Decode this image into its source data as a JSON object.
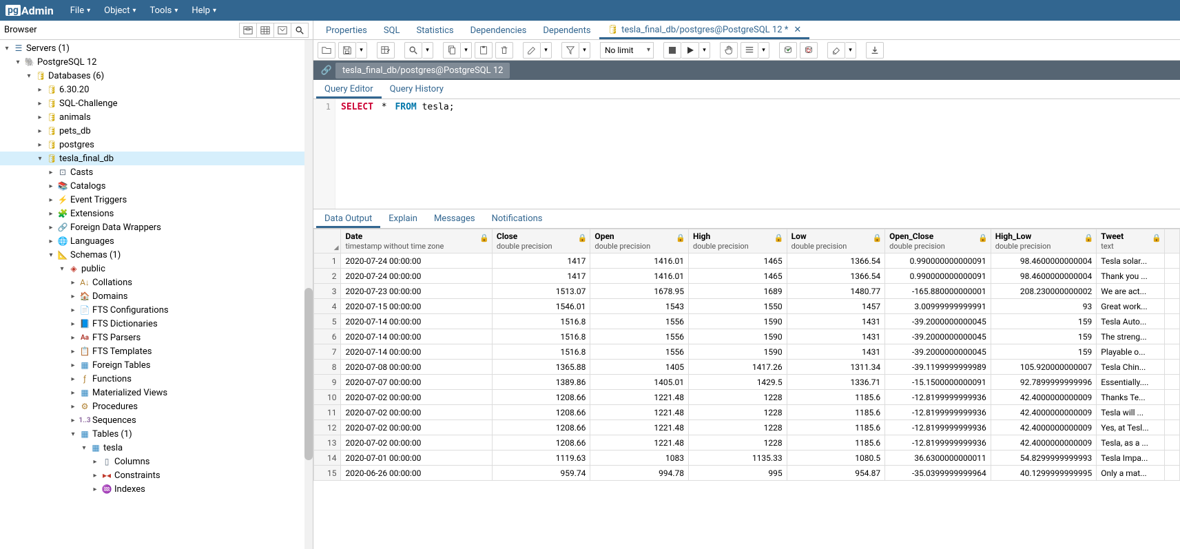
{
  "logo": {
    "pg": "pg",
    "admin": "Admin"
  },
  "menus": {
    "file": "File",
    "object": "Object",
    "tools": "Tools",
    "help": "Help"
  },
  "browser": {
    "title": "Browser"
  },
  "tree": {
    "servers": "Servers (1)",
    "pg12": "PostgreSQL 12",
    "databases": "Databases (6)",
    "db1": "6.30.20",
    "db2": "SQL-Challenge",
    "db3": "animals",
    "db4": "pets_db",
    "db5": "postgres",
    "db6": "tesla_final_db",
    "casts": "Casts",
    "catalogs": "Catalogs",
    "event_triggers": "Event Triggers",
    "extensions": "Extensions",
    "fdw": "Foreign Data Wrappers",
    "languages": "Languages",
    "schemas": "Schemas (1)",
    "public": "public",
    "collations": "Collations",
    "domains": "Domains",
    "fts_conf": "FTS Configurations",
    "fts_dict": "FTS Dictionaries",
    "fts_parsers": "FTS Parsers",
    "fts_templates": "FTS Templates",
    "foreign_tables": "Foreign Tables",
    "functions": "Functions",
    "mat_views": "Materialized Views",
    "procedures": "Procedures",
    "sequences": "Sequences",
    "tables": "Tables (1)",
    "tesla": "tesla",
    "columns": "Columns",
    "constraints": "Constraints",
    "indexes": "Indexes"
  },
  "tabs": {
    "properties": "Properties",
    "sql": "SQL",
    "statistics": "Statistics",
    "dependencies": "Dependencies",
    "dependents": "Dependents",
    "query": "tesla_final_db/postgres@PostgreSQL 12 *"
  },
  "toolbar": {
    "nolimit": "No limit"
  },
  "conn": "tesla_final_db/postgres@PostgreSQL 12",
  "editor_tabs": {
    "query_editor": "Query Editor",
    "query_history": "Query History"
  },
  "query": {
    "line": "1",
    "select": "SELECT",
    "star": "*",
    "from": "FROM",
    "rest": " tesla;"
  },
  "output_tabs": {
    "data_output": "Data Output",
    "explain": "Explain",
    "messages": "Messages",
    "notifications": "Notifications"
  },
  "cols": [
    {
      "name": "Date",
      "type": "timestamp without time zone"
    },
    {
      "name": "Close",
      "type": "double precision"
    },
    {
      "name": "Open",
      "type": "double precision"
    },
    {
      "name": "High",
      "type": "double precision"
    },
    {
      "name": "Low",
      "type": "double precision"
    },
    {
      "name": "Open_Close",
      "type": "double precision"
    },
    {
      "name": "High_Low",
      "type": "double precision"
    },
    {
      "name": "Tweet",
      "type": "text"
    }
  ],
  "rows": [
    [
      "1",
      "2020-07-24 00:00:00",
      "1417",
      "1416.01",
      "1465",
      "1366.54",
      "0.990000000000091",
      "98.4600000000004",
      "Tesla solar..."
    ],
    [
      "2",
      "2020-07-24 00:00:00",
      "1417",
      "1416.01",
      "1465",
      "1366.54",
      "0.990000000000091",
      "98.4600000000004",
      "Thank you ..."
    ],
    [
      "3",
      "2020-07-23 00:00:00",
      "1513.07",
      "1678.95",
      "1689",
      "1480.77",
      "-165.880000000001",
      "208.230000000002",
      "We are act..."
    ],
    [
      "4",
      "2020-07-15 00:00:00",
      "1546.01",
      "1543",
      "1550",
      "1457",
      "3.00999999999991",
      "93",
      "Great work..."
    ],
    [
      "5",
      "2020-07-14 00:00:00",
      "1516.8",
      "1556",
      "1590",
      "1431",
      "-39.2000000000045",
      "159",
      "Tesla Auto..."
    ],
    [
      "6",
      "2020-07-14 00:00:00",
      "1516.8",
      "1556",
      "1590",
      "1431",
      "-39.2000000000045",
      "159",
      "The streng..."
    ],
    [
      "7",
      "2020-07-14 00:00:00",
      "1516.8",
      "1556",
      "1590",
      "1431",
      "-39.2000000000045",
      "159",
      "Playable o..."
    ],
    [
      "8",
      "2020-07-08 00:00:00",
      "1365.88",
      "1405",
      "1417.26",
      "1311.34",
      "-39.1199999999989",
      "105.920000000007",
      "Tesla Chin..."
    ],
    [
      "9",
      "2020-07-07 00:00:00",
      "1389.86",
      "1405.01",
      "1429.5",
      "1336.71",
      "-15.1500000000091",
      "92.7899999999996",
      "Essentially...."
    ],
    [
      "10",
      "2020-07-02 00:00:00",
      "1208.66",
      "1221.48",
      "1228",
      "1185.6",
      "-12.8199999999936",
      "42.4000000000009",
      "Thanks Te..."
    ],
    [
      "11",
      "2020-07-02 00:00:00",
      "1208.66",
      "1221.48",
      "1228",
      "1185.6",
      "-12.8199999999936",
      "42.4000000000009",
      "Tesla will ..."
    ],
    [
      "12",
      "2020-07-02 00:00:00",
      "1208.66",
      "1221.48",
      "1228",
      "1185.6",
      "-12.8199999999936",
      "42.4000000000009",
      "Yes, at Tesl..."
    ],
    [
      "13",
      "2020-07-02 00:00:00",
      "1208.66",
      "1221.48",
      "1228",
      "1185.6",
      "-12.8199999999936",
      "42.4000000000009",
      "Tesla, as a ..."
    ],
    [
      "14",
      "2020-07-01 00:00:00",
      "1119.63",
      "1083",
      "1135.33",
      "1080.5",
      "36.6300000000011",
      "54.8299999999993",
      "Tesla Impa..."
    ],
    [
      "15",
      "2020-06-26 00:00:00",
      "959.74",
      "994.78",
      "995",
      "954.87",
      "-35.0399999999964",
      "40.1299999999995",
      "Only a mat..."
    ]
  ]
}
